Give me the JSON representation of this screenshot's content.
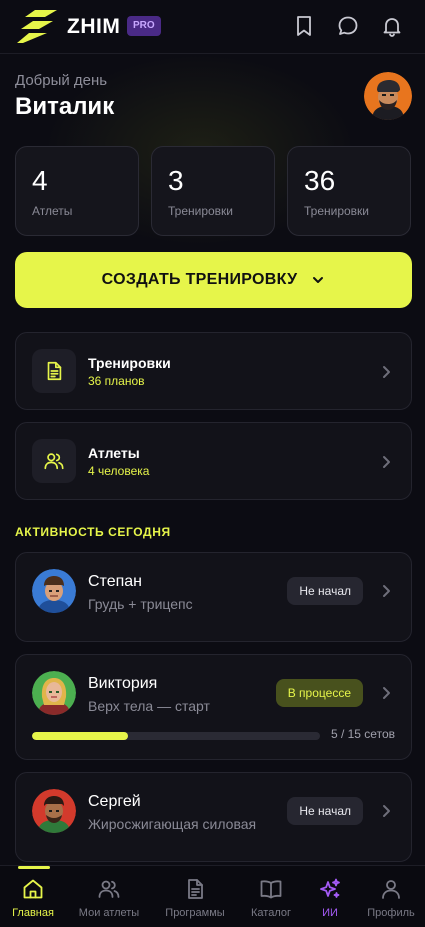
{
  "header": {
    "brand": "ZHIM",
    "badge": "PRO",
    "icons": [
      "bookmark-icon",
      "chat-icon",
      "bell-icon"
    ]
  },
  "greeting": {
    "subtitle": "Добрый день",
    "name": "Виталик"
  },
  "stats": [
    {
      "value": "4",
      "label": "Атлеты"
    },
    {
      "value": "3",
      "label": "Тренировки"
    },
    {
      "value": "36",
      "label": "Тренировки"
    }
  ],
  "cta": {
    "label": "СОЗДАТЬ ТРЕНИРОВКУ"
  },
  "menu": [
    {
      "title": "Тренировки",
      "subtitle": "36 планов",
      "icon": "document-icon"
    },
    {
      "title": "Атлеты",
      "subtitle": "4 человека",
      "icon": "users-icon"
    }
  ],
  "activity": {
    "title": "АКТИВНОСТЬ СЕГОДНЯ",
    "items": [
      {
        "name": "Степан",
        "workout": "Грудь + трицепс",
        "status": "Не начал"
      },
      {
        "name": "Виктория",
        "workout": "Верх тела — старт",
        "status": "В процессе",
        "progress_text": "5 / 15 сетов",
        "progress_fraction": 0.333
      },
      {
        "name": "Сергей",
        "workout": "Жиросжигающая силовая",
        "status": "Не начал"
      }
    ]
  },
  "tabs": [
    {
      "label": "Главная",
      "icon": "home-icon",
      "active": true
    },
    {
      "label": "Мои атлеты",
      "icon": "users-icon"
    },
    {
      "label": "Программы",
      "icon": "document-icon"
    },
    {
      "label": "Каталог",
      "icon": "book-icon"
    },
    {
      "label": "ИИ",
      "icon": "sparkles-icon"
    },
    {
      "label": "Профиль",
      "icon": "person-icon"
    }
  ],
  "colors": {
    "accent": "#e6f54a",
    "background": "#0c0c13",
    "card": "#121219",
    "ai": "#a45bf5",
    "pro_badge": "#4a2a86"
  }
}
